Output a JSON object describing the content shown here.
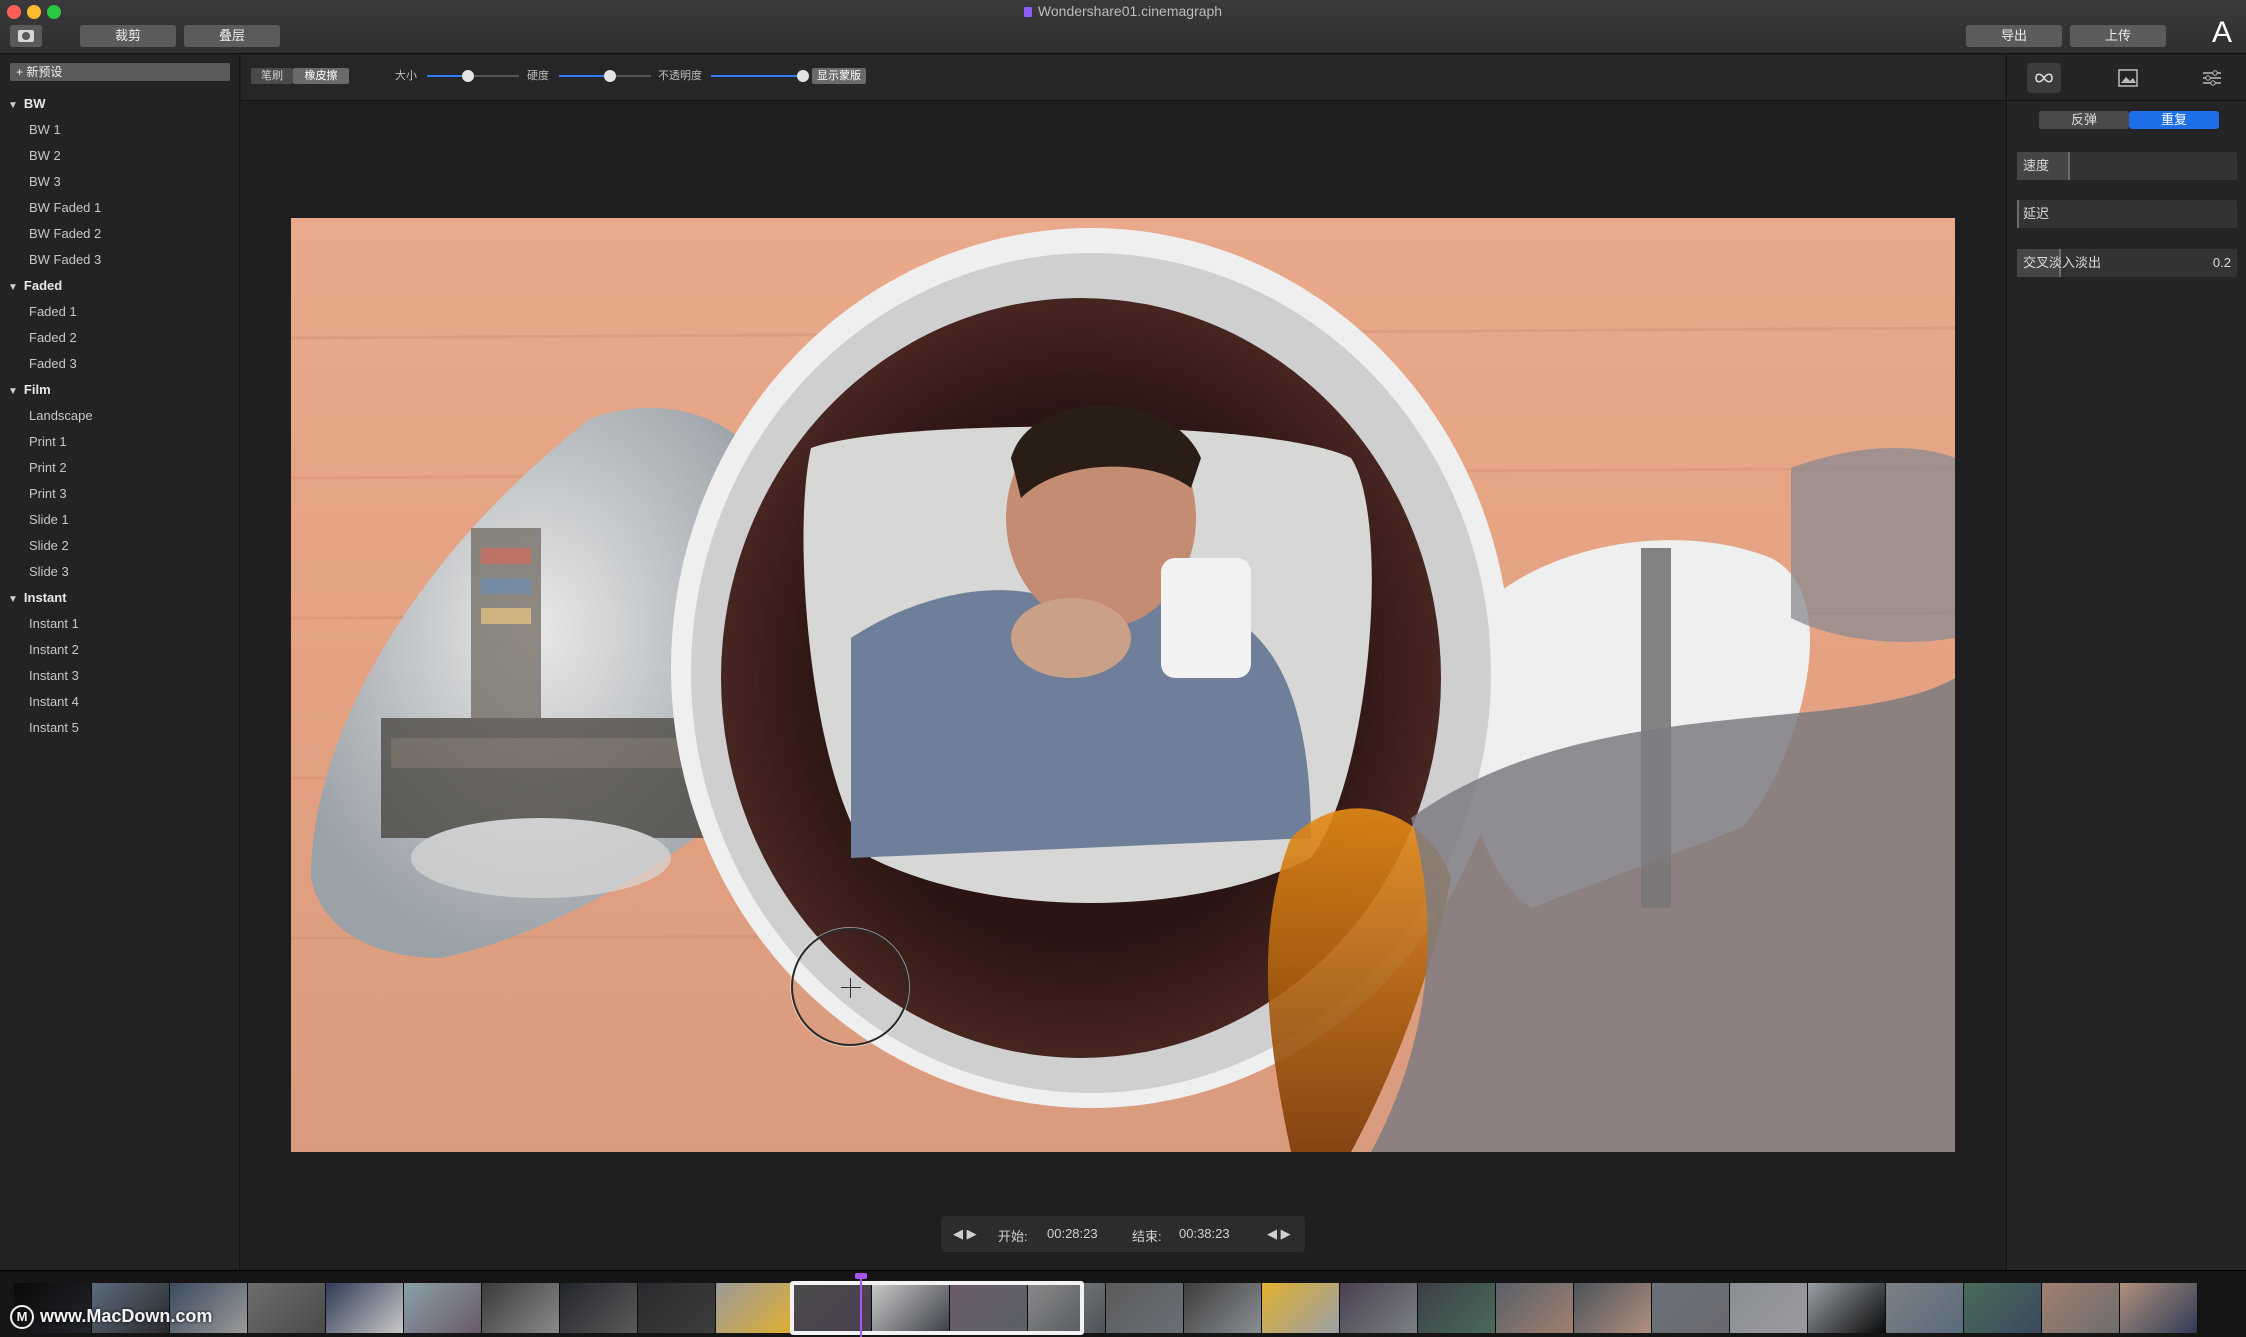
{
  "window": {
    "title": "Wondershare01.cinemagraph"
  },
  "toolbar": {
    "crop_label": "裁剪",
    "layers_label": "叠层",
    "export_label": "导出",
    "upload_label": "上传",
    "corner_glyph": "A"
  },
  "sidebar": {
    "new_preset_label": "+ 新预设",
    "groups": [
      {
        "name": "BW",
        "items": [
          "BW 1",
          "BW 2",
          "BW 3",
          "BW Faded 1",
          "BW Faded 2",
          "BW Faded 3"
        ]
      },
      {
        "name": "Faded",
        "items": [
          "Faded 1",
          "Faded 2",
          "Faded 3"
        ]
      },
      {
        "name": "Film",
        "items": [
          "Landscape",
          "Print 1",
          "Print 2",
          "Print 3",
          "Slide 1",
          "Slide 2",
          "Slide 3"
        ]
      },
      {
        "name": "Instant",
        "items": [
          "Instant 1",
          "Instant 2",
          "Instant 3",
          "Instant 4",
          "Instant 5"
        ]
      }
    ]
  },
  "brush_bar": {
    "brush_label": "笔刷",
    "erase_label": "橡皮擦",
    "size_label": "大小",
    "hardness_label": "硬度",
    "opacity_label": "不透明度",
    "show_mask_label": "显示蒙版",
    "size_value": 0.45,
    "hardness_value": 0.55,
    "opacity_value": 1.0,
    "accent": "#2e7cf6"
  },
  "trim": {
    "start_label": "开始:",
    "start_time": "00:28:23",
    "end_label": "结束:",
    "end_time": "00:38:23"
  },
  "right_panel": {
    "mode_bounce_label": "反弹",
    "mode_repeat_label": "重复",
    "speed_label": "速度",
    "speed_value": 0.24,
    "delay_label": "延迟",
    "delay_value": 0.0,
    "crossfade_label": "交叉淡入淡出",
    "crossfade_value": "0.2",
    "accent": "#1e6fe8"
  },
  "filmstrip": {
    "watermark": "www.MacDown.com"
  }
}
